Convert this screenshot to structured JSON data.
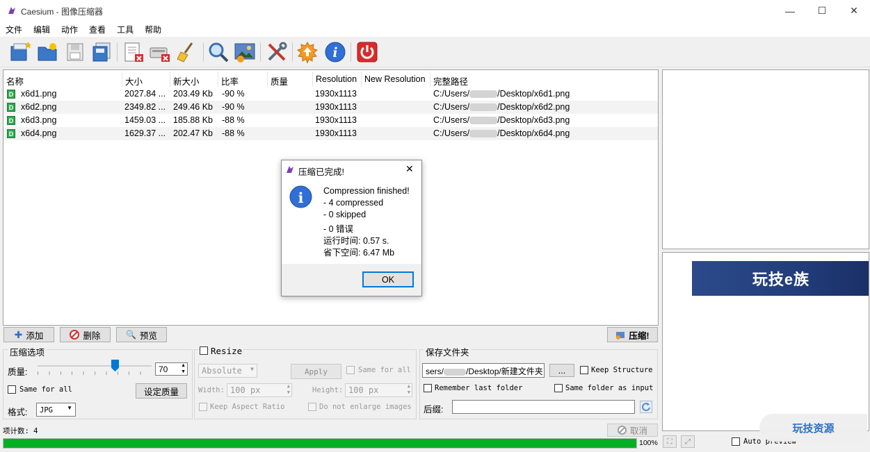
{
  "window": {
    "title": "Caesium - 图像压缩器",
    "minimize": "—",
    "maximize": "☐",
    "close": "✕"
  },
  "menu": [
    "文件",
    "编辑",
    "动作",
    "查看",
    "工具",
    "帮助"
  ],
  "toolbar": {
    "icons": [
      "add-files-icon",
      "add-folder-icon",
      "save-icon",
      "save-list-icon",
      "remove-icon",
      "clear-list-icon",
      "clean-icon",
      "preview-icon",
      "image-preview-icon",
      "settings-icon",
      "update-icon",
      "info-icon",
      "exit-icon"
    ],
    "info_glyph": "i"
  },
  "table": {
    "headers": [
      "名称",
      "大小",
      "新大小",
      "比率",
      "质量",
      "Resolution",
      "New Resolution",
      "完整路径"
    ],
    "file_badge": "D",
    "rows": [
      {
        "name": "x6d1.png",
        "size": "2027.84 ...",
        "new_size": "203.49 Kb",
        "ratio": "-90 %",
        "quality": "",
        "resolution": "1930x1113",
        "new_resolution": "",
        "path": "C:/Users/",
        "path_tail": "/Desktop/x6d1.png"
      },
      {
        "name": "x6d2.png",
        "size": "2349.82 ...",
        "new_size": "249.46 Kb",
        "ratio": "-90 %",
        "quality": "",
        "resolution": "1930x1113",
        "new_resolution": "",
        "path": "C:/Users/",
        "path_tail": "/Desktop/x6d2.png"
      },
      {
        "name": "x6d3.png",
        "size": "1459.03 ...",
        "new_size": "185.88 Kb",
        "ratio": "-88 %",
        "quality": "",
        "resolution": "1930x1113",
        "new_resolution": "",
        "path": "C:/Users/",
        "path_tail": "/Desktop/x6d3.png"
      },
      {
        "name": "x6d4.png",
        "size": "1629.37 ...",
        "new_size": "202.47 Kb",
        "ratio": "-88 %",
        "quality": "",
        "resolution": "1930x1113",
        "new_resolution": "",
        "path": "C:/Users/",
        "path_tail": "/Desktop/x6d4.png"
      }
    ]
  },
  "buttons": {
    "add": "添加",
    "delete": "删除",
    "preview": "预览",
    "compress": "压缩!",
    "cancel": "取消"
  },
  "compression": {
    "title": "压缩选项",
    "quality_label": "质量:",
    "quality_value": "70",
    "quality_level": 0.7,
    "same_for_all": "Same for all",
    "set_quality": "设定质量",
    "format_label": "格式:",
    "format_value": "JPG"
  },
  "resize": {
    "title": "Resize",
    "mode": "Absolute",
    "apply": "Apply",
    "same_for_all": "Same for all",
    "width_label": "Width:",
    "width_value": "100 px",
    "height_label": "Height:",
    "height_value": "100 px",
    "keep_aspect": "Keep Aspect Ratio",
    "no_enlarge": "Do not enlarge images"
  },
  "output": {
    "title": "保存文件夹",
    "folder_prefix": "sers/",
    "folder_tail": "/Desktop/新建文件夹",
    "browse": "...",
    "keep_structure": "Keep Structure",
    "remember_last": "Remember last folder",
    "same_folder": "Same folder as input",
    "suffix_label": "后缀:",
    "suffix_value": ""
  },
  "status": {
    "item_count": "项计数: 4",
    "progress_text": "100%",
    "progress": 1.0,
    "auto_preview": "Auto preview"
  },
  "watermark": {
    "banner": "玩技e族",
    "badge": "玩技资源"
  },
  "dialog": {
    "title": "压缩已完成!",
    "lines": [
      "Compression finished!",
      "- 4 compressed",
      "- 0 skipped",
      "- 0 错误",
      "运行时间: 0.57 s.",
      "省下空间: 6.47 Mb"
    ],
    "ok": "OK",
    "close": "✕",
    "icon_glyph": "i"
  },
  "colors": {
    "progress": "#06b025",
    "dialog_icon": "#2f6fd6",
    "accent_border": "#0078d7"
  }
}
